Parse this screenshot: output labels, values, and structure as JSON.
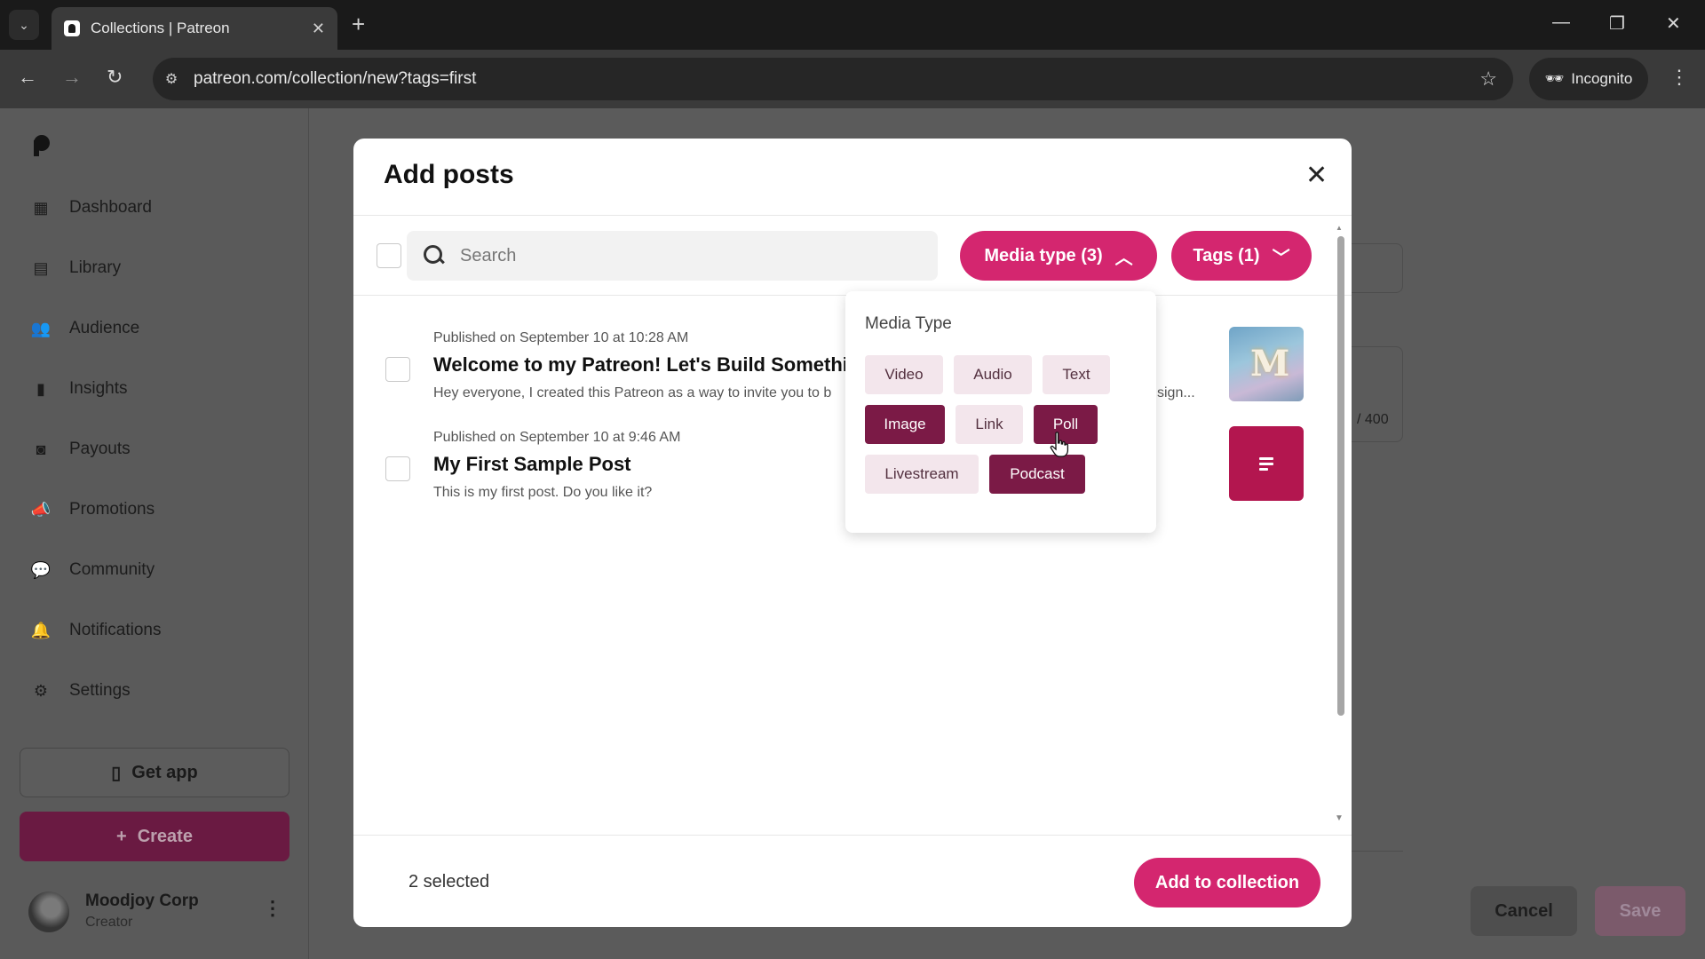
{
  "browser": {
    "tab_title": "Collections | Patreon",
    "url": "patreon.com/collection/new?tags=first",
    "incognito_label": "Incognito"
  },
  "sidebar": {
    "items": [
      {
        "label": "Dashboard",
        "icon": "dashboard-icon"
      },
      {
        "label": "Library",
        "icon": "library-icon"
      },
      {
        "label": "Audience",
        "icon": "audience-icon"
      },
      {
        "label": "Insights",
        "icon": "insights-icon"
      },
      {
        "label": "Payouts",
        "icon": "payouts-icon"
      },
      {
        "label": "Promotions",
        "icon": "promotions-icon"
      },
      {
        "label": "Community",
        "icon": "community-icon"
      },
      {
        "label": "Notifications",
        "icon": "bell-icon"
      },
      {
        "label": "Settings",
        "icon": "gear-icon"
      }
    ],
    "get_app_label": "Get app",
    "create_label": "Create",
    "user": {
      "name": "Moodjoy Corp",
      "role": "Creator"
    }
  },
  "background": {
    "counter_text": "/ 400",
    "cancel_label": "Cancel",
    "save_label": "Save"
  },
  "modal": {
    "title": "Add posts",
    "search_placeholder": "Search",
    "media_type_label": "Media type (3)",
    "tags_label": "Tags (1)",
    "posts": [
      {
        "date": "Published on September 10 at 10:28 AM",
        "title": "Welcome to my Patreon! Let's Build Something",
        "description": "Hey everyone, I created this Patreon as a way to invite you to b",
        "description_tail": "sign..."
      },
      {
        "date": "Published on September 10 at 9:46 AM",
        "title": "My First Sample Post",
        "description": "This is my first post. Do you like it?"
      }
    ],
    "selected_count": "2 selected",
    "add_button_label": "Add to collection"
  },
  "media_type_dropdown": {
    "heading": "Media Type",
    "options": [
      {
        "label": "Video",
        "selected": false
      },
      {
        "label": "Audio",
        "selected": false
      },
      {
        "label": "Text",
        "selected": false
      },
      {
        "label": "Image",
        "selected": true
      },
      {
        "label": "Link",
        "selected": false
      },
      {
        "label": "Poll",
        "selected": true
      },
      {
        "label": "Livestream",
        "selected": false
      },
      {
        "label": "Podcast",
        "selected": true
      }
    ]
  },
  "colors": {
    "accent": "#d4266f",
    "chip_selected": "#7b1a46",
    "chip_unselected": "#f3e6ec"
  }
}
